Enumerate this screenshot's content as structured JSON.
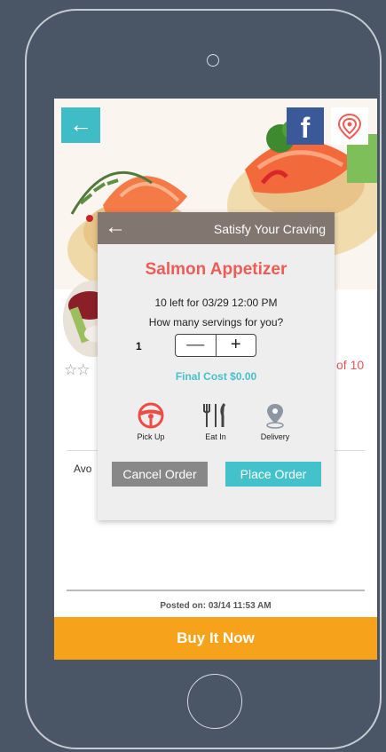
{
  "screen": {
    "back_icon": "arrow-left-icon",
    "facebook_label": "f",
    "partial_text_right": "of 10",
    "partial_text_left": "Avo",
    "posted": "Posted on: 03/14 11:53 AM",
    "buy_label": "Buy It Now"
  },
  "modal": {
    "header_title": "Satisfy Your Craving",
    "back_icon": "arrow-left-icon",
    "item_title": "Salmon Appetizer",
    "availability": "10 left for 03/29 12:00 PM",
    "question": "How many servings for you?",
    "quantity": "1",
    "minus": "—",
    "plus": "+",
    "final_cost": "Final Cost $0.00",
    "options": [
      {
        "label": "Pick Up",
        "icon": "steering-wheel-icon"
      },
      {
        "label": "Eat In",
        "icon": "fork-knife-icon"
      },
      {
        "label": "Delivery",
        "icon": "location-pin-icon"
      }
    ],
    "cancel_label": "Cancel Order",
    "place_label": "Place Order"
  },
  "colors": {
    "accent_teal": "#43c2cc",
    "title_red": "#ee5b56",
    "buy_orange": "#f7a21b",
    "modal_header": "#817670"
  }
}
